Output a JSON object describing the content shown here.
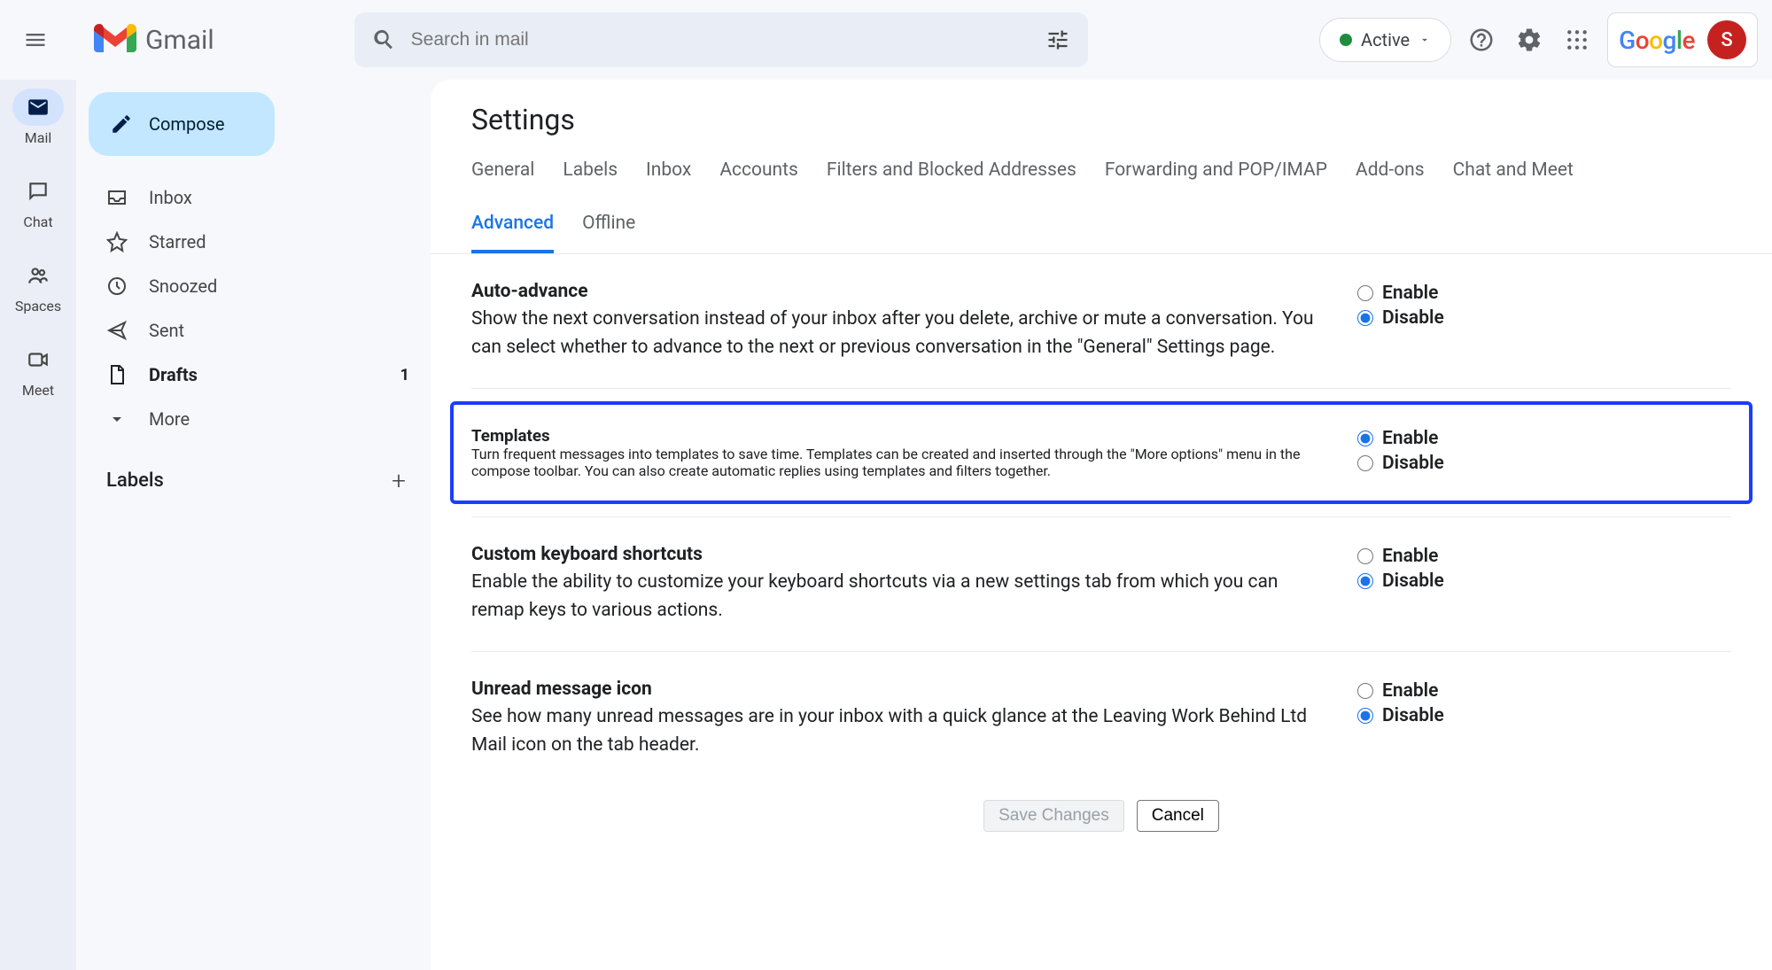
{
  "header": {
    "logo_text": "Gmail",
    "search_placeholder": "Search in mail",
    "status_label": "Active",
    "google_text": "Google",
    "avatar_initial": "S"
  },
  "rail": {
    "items": [
      {
        "label": "Mail"
      },
      {
        "label": "Chat"
      },
      {
        "label": "Spaces"
      },
      {
        "label": "Meet"
      }
    ]
  },
  "sidebar": {
    "compose_label": "Compose",
    "items": [
      {
        "label": "Inbox"
      },
      {
        "label": "Starred"
      },
      {
        "label": "Snoozed"
      },
      {
        "label": "Sent"
      },
      {
        "label": "Drafts",
        "count": "1"
      },
      {
        "label": "More"
      }
    ],
    "labels_header": "Labels"
  },
  "main": {
    "title": "Settings",
    "tabs_row1": [
      "General",
      "Labels",
      "Inbox",
      "Accounts",
      "Filters and Blocked Addresses",
      "Forwarding and POP/IMAP",
      "Add-ons",
      "Chat and Meet"
    ],
    "tabs_row2": [
      "Advanced",
      "Offline"
    ],
    "active_tab": "Advanced",
    "settings": [
      {
        "id": "auto-advance",
        "title": "Auto-advance",
        "desc": "Show the next conversation instead of your inbox after you delete, archive or mute a conversation. You can select whether to advance to the next or previous conversation in the \"General\" Settings page.",
        "enable": "Enable",
        "disable": "Disable",
        "selected": "disable"
      },
      {
        "id": "templates",
        "title": "Templates",
        "desc": "Turn frequent messages into templates to save time. Templates can be created and inserted through the \"More options\" menu in the compose toolbar. You can also create automatic replies using templates and filters together.",
        "enable": "Enable",
        "disable": "Disable",
        "selected": "enable",
        "highlighted": true
      },
      {
        "id": "custom-shortcuts",
        "title": "Custom keyboard shortcuts",
        "desc": "Enable the ability to customize your keyboard shortcuts via a new settings tab from which you can remap keys to various actions.",
        "enable": "Enable",
        "disable": "Disable",
        "selected": "disable"
      },
      {
        "id": "unread-icon",
        "title": "Unread message icon",
        "desc": "See how many unread messages are in your inbox with a quick glance at the Leaving Work Behind Ltd Mail icon on the tab header.",
        "enable": "Enable",
        "disable": "Disable",
        "selected": "disable"
      }
    ],
    "save_label": "Save Changes",
    "cancel_label": "Cancel"
  }
}
